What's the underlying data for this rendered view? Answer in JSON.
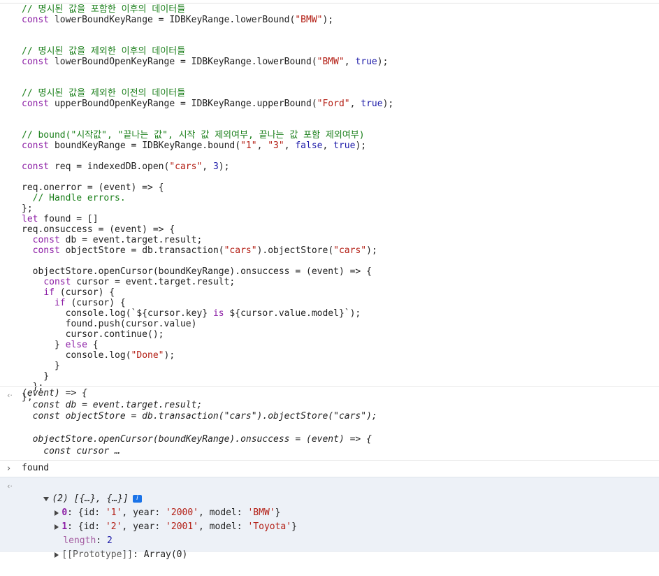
{
  "code_lines": [
    [
      {
        "t": "// 명시된 값을 포함한 이후의 데이터들",
        "c": "com"
      }
    ],
    [
      {
        "t": "const",
        "c": "kw"
      },
      {
        "t": " lowerBoundKeyRange = IDBKeyRange.lowerBound(",
        "c": "plain"
      },
      {
        "t": "\"BMW\"",
        "c": "str"
      },
      {
        "t": ");",
        "c": "plain"
      }
    ],
    [],
    [],
    [
      {
        "t": "// 명시된 값을 제외한 이후의 데이터들",
        "c": "com"
      }
    ],
    [
      {
        "t": "const",
        "c": "kw"
      },
      {
        "t": " lowerBoundOpenKeyRange = IDBKeyRange.lowerBound(",
        "c": "plain"
      },
      {
        "t": "\"BMW\"",
        "c": "str"
      },
      {
        "t": ", ",
        "c": "plain"
      },
      {
        "t": "true",
        "c": "bool"
      },
      {
        "t": ");",
        "c": "plain"
      }
    ],
    [],
    [],
    [
      {
        "t": "// 명시된 값을 제외한 이전의 데이터들",
        "c": "com"
      }
    ],
    [
      {
        "t": "const",
        "c": "kw"
      },
      {
        "t": " upperBoundOpenKeyRange = IDBKeyRange.upperBound(",
        "c": "plain"
      },
      {
        "t": "\"Ford\"",
        "c": "str"
      },
      {
        "t": ", ",
        "c": "plain"
      },
      {
        "t": "true",
        "c": "bool"
      },
      {
        "t": ");",
        "c": "plain"
      }
    ],
    [],
    [],
    [
      {
        "t": "// bound(\"시작값\", \"끝나는 값\", 시작 값 제외여부, 끝나는 값 포함 제외여부)",
        "c": "com"
      }
    ],
    [
      {
        "t": "const",
        "c": "kw"
      },
      {
        "t": " boundKeyRange = IDBKeyRange.bound(",
        "c": "plain"
      },
      {
        "t": "\"1\"",
        "c": "str"
      },
      {
        "t": ", ",
        "c": "plain"
      },
      {
        "t": "\"3\"",
        "c": "str"
      },
      {
        "t": ", ",
        "c": "plain"
      },
      {
        "t": "false",
        "c": "bool"
      },
      {
        "t": ", ",
        "c": "plain"
      },
      {
        "t": "true",
        "c": "bool"
      },
      {
        "t": ");",
        "c": "plain"
      }
    ],
    [],
    [
      {
        "t": "const",
        "c": "kw"
      },
      {
        "t": " req = indexedDB.open(",
        "c": "plain"
      },
      {
        "t": "\"cars\"",
        "c": "str"
      },
      {
        "t": ", ",
        "c": "plain"
      },
      {
        "t": "3",
        "c": "num"
      },
      {
        "t": ");",
        "c": "plain"
      }
    ],
    [],
    [
      {
        "t": "req.onerror = (event) => {",
        "c": "plain"
      }
    ],
    [
      {
        "t": "  // Handle errors.",
        "c": "com"
      }
    ],
    [
      {
        "t": "};",
        "c": "plain"
      }
    ],
    [
      {
        "t": "let",
        "c": "kw"
      },
      {
        "t": " found = []",
        "c": "plain"
      }
    ],
    [
      {
        "t": "req.onsuccess = (event) => {",
        "c": "plain"
      }
    ],
    [
      {
        "t": "  ",
        "c": "plain"
      },
      {
        "t": "const",
        "c": "kw"
      },
      {
        "t": " db = event.target.result;",
        "c": "plain"
      }
    ],
    [
      {
        "t": "  ",
        "c": "plain"
      },
      {
        "t": "const",
        "c": "kw"
      },
      {
        "t": " objectStore = db.transaction(",
        "c": "plain"
      },
      {
        "t": "\"cars\"",
        "c": "str"
      },
      {
        "t": ").objectStore(",
        "c": "plain"
      },
      {
        "t": "\"cars\"",
        "c": "str"
      },
      {
        "t": ");",
        "c": "plain"
      }
    ],
    [],
    [
      {
        "t": "  objectStore.openCursor(boundKeyRange).onsuccess = (event) => {",
        "c": "plain"
      }
    ],
    [
      {
        "t": "    ",
        "c": "plain"
      },
      {
        "t": "const",
        "c": "kw"
      },
      {
        "t": " cursor = event.target.result;",
        "c": "plain"
      }
    ],
    [
      {
        "t": "    ",
        "c": "plain"
      },
      {
        "t": "if",
        "c": "kw"
      },
      {
        "t": " (cursor) {",
        "c": "plain"
      }
    ],
    [
      {
        "t": "      ",
        "c": "plain"
      },
      {
        "t": "if",
        "c": "kw"
      },
      {
        "t": " (cursor) {",
        "c": "plain"
      }
    ],
    [
      {
        "t": "        console.log(`${cursor.key} ",
        "c": "plain"
      },
      {
        "t": "is",
        "c": "kw"
      },
      {
        "t": " ${cursor.value.model}`);",
        "c": "plain"
      }
    ],
    [
      {
        "t": "        found.push(cursor.value)",
        "c": "plain"
      }
    ],
    [
      {
        "t": "        cursor.continue();",
        "c": "plain"
      }
    ],
    [
      {
        "t": "      } ",
        "c": "plain"
      },
      {
        "t": "else",
        "c": "kw"
      },
      {
        "t": " {",
        "c": "plain"
      }
    ],
    [
      {
        "t": "        console.log(",
        "c": "plain"
      },
      {
        "t": "\"Done\"",
        "c": "str"
      },
      {
        "t": ");",
        "c": "plain"
      }
    ],
    [
      {
        "t": "      }",
        "c": "plain"
      }
    ],
    [
      {
        "t": "    }",
        "c": "plain"
      }
    ],
    [
      {
        "t": "  };",
        "c": "plain"
      }
    ],
    [
      {
        "t": "};",
        "c": "plain"
      }
    ]
  ],
  "result_preview": [
    "(event) => {",
    "  const db = event.target.result;",
    "  const objectStore = db.transaction(\"cars\").objectStore(\"cars\");",
    "",
    "  objectStore.openCursor(boundKeyRange).onsuccess = (event) => {",
    "    const cursor …"
  ],
  "icons": {
    "result_arrow": "‹·",
    "input_prompt": "›"
  },
  "found_input": "found",
  "array_output": {
    "summary": "(2) [{…}, {…}]",
    "info_badge": "i",
    "items": [
      {
        "index": "0",
        "id": "'1'",
        "year": "'2000'",
        "model": "'BMW'"
      },
      {
        "index": "1",
        "id": "'2'",
        "year": "'2001'",
        "model": "'Toyota'"
      }
    ],
    "length_key": "length",
    "length_value": "2",
    "prototype_key": "[[Prototype]]",
    "prototype_value": "Array(0)"
  },
  "colors": {
    "comment": "#1a7f1a",
    "keyword": "#8c1ea5",
    "string": "#b31d13",
    "number": "#1c1aa8",
    "selected_bg": "#edf1f7"
  }
}
